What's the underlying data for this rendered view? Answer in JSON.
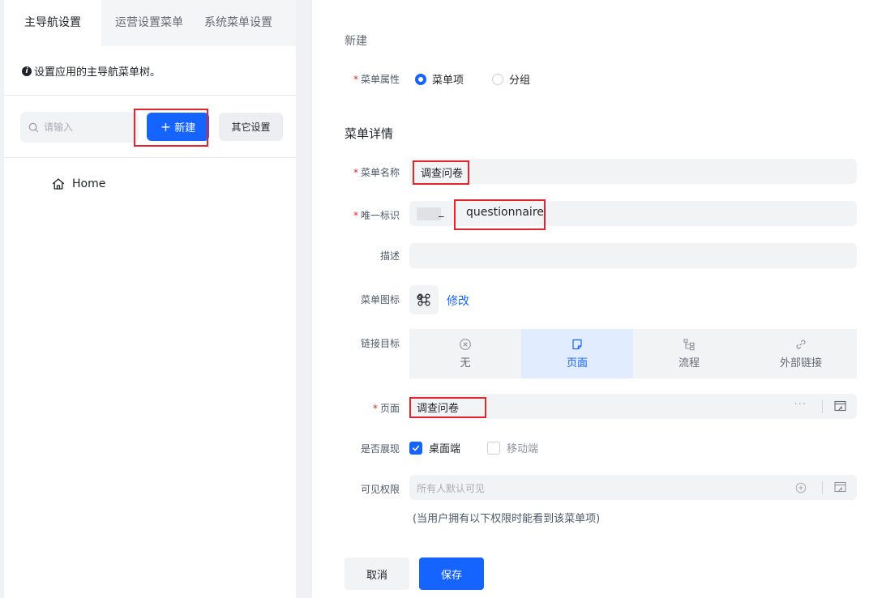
{
  "left_panel": {
    "tabs": [
      {
        "label": "主导航设置",
        "active": true
      },
      {
        "label": "运营设置菜单",
        "active": false
      },
      {
        "label": "系统菜单设置",
        "active": false
      }
    ],
    "tip": "设置应用的主导航菜单树。",
    "search_placeholder": "请输入",
    "new_button": "新建",
    "other_settings_button": "其它设置",
    "tree": [
      {
        "label": "Home",
        "icon": "home-icon"
      }
    ]
  },
  "form": {
    "title": "新建",
    "menu_attr": {
      "label": "菜单属性",
      "options": [
        {
          "label": "菜单项",
          "selected": true
        },
        {
          "label": "分组",
          "selected": false
        }
      ]
    },
    "section_title": "菜单详情",
    "menu_name": {
      "label": "菜单名称",
      "value": "调查问卷"
    },
    "unique_id": {
      "label": "唯一标识",
      "prefix_sep": "_",
      "value": "questionnaire"
    },
    "description": {
      "label": "描述",
      "value": ""
    },
    "menu_icon": {
      "label": "菜单图标",
      "icon": "command-icon",
      "edit_link": "修改"
    },
    "link_target": {
      "label": "链接目标",
      "options": [
        {
          "label": "无",
          "icon": "close-circle-icon",
          "selected": false
        },
        {
          "label": "页面",
          "icon": "page-icon",
          "selected": true
        },
        {
          "label": "流程",
          "icon": "flow-icon",
          "selected": false
        },
        {
          "label": "外部链接",
          "icon": "link-icon",
          "selected": false
        }
      ]
    },
    "page": {
      "label": "页面",
      "value": "调查问卷",
      "more": "···"
    },
    "display": {
      "label": "是否展现",
      "options": [
        {
          "label": "桌面端",
          "checked": true
        },
        {
          "label": "移动端",
          "checked": false
        }
      ]
    },
    "visibility": {
      "label": "可见权限",
      "placeholder": "所有人默认可见",
      "hint": "(当用户拥有以下权限时能看到该菜单项)"
    },
    "cancel_button": "取消",
    "save_button": "保存"
  },
  "colors": {
    "primary": "#1664ff",
    "required": "#e0252d",
    "highlight_box": "#e0252d"
  }
}
